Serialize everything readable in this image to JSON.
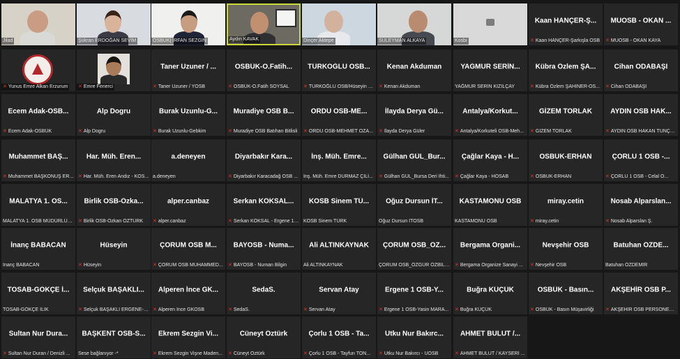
{
  "colors": {
    "background": "#171717",
    "tile": "#262626",
    "active_border": "#c9d836",
    "mic_muted": "#e0362c"
  },
  "icons": {
    "mic_muted": "muted-mic-icon",
    "no_camera": "camera-off-icon"
  },
  "rows": [
    [
      {
        "caption": "Jilad",
        "video": true,
        "mic": false
      },
      {
        "caption": "Şükran ERDOĞAN SEVİM",
        "video": true,
        "mic": false
      },
      {
        "caption": "OSBÜK| İRFAN SEZGİN",
        "video": true,
        "mic": false
      },
      {
        "caption": "Aydın KAVAK",
        "video": true,
        "mic": false,
        "active": true
      },
      {
        "caption": "Dinçer Aktepe",
        "video": true,
        "mic": false
      },
      {
        "caption": "SÜLEYMAN ALKAYA",
        "video": true,
        "mic": false
      },
      {
        "caption": "Kosbi",
        "video": true,
        "mic": false,
        "placeholder": true
      },
      {
        "name": "Kaan HANÇER-Ş...",
        "caption": "Kaan HANÇER-Şarkışla OSB",
        "mic": true
      },
      {
        "name": "MUOSB - OKAN ...",
        "caption": "MUOSB - OKAN KAYA",
        "mic": true
      }
    ],
    [
      {
        "caption": "Yunus Emre Alkan Erzurum",
        "video": true,
        "mic": true,
        "logo": true
      },
      {
        "caption": "Emre Fenerci",
        "video": true,
        "mic": true,
        "portrait": true
      },
      {
        "name": "Taner Uzuner / ...",
        "caption": "Taner Uzuner / YOSB",
        "mic": true
      },
      {
        "name": "OSBÜK-O.Fatih...",
        "caption": "OSBÜK-O.Fatih SOYSAL",
        "mic": true
      },
      {
        "name": "TÜRKOĞLU OSB...",
        "caption": "TÜRKOĞLU OSB/Hüseyin Ş...",
        "mic": true
      },
      {
        "name": "Kenan Akduman",
        "caption": "Kenan Akduman",
        "mic": true
      },
      {
        "name": "YAĞMUR SERİN...",
        "caption": "YAĞMUR SERİN KIZILÇAY",
        "mic": false
      },
      {
        "name": "Kübra Özlem ŞA...",
        "caption": "Kübra Özlem ŞAHİNER-OS...",
        "mic": true
      },
      {
        "name": "Cihan ODABAŞI",
        "caption": "Cihan ODABAŞI",
        "mic": true
      }
    ],
    [
      {
        "name": "Ecem Adak-OSB...",
        "caption": "Ecem Adak-OSBÜK",
        "mic": true
      },
      {
        "name": "Alp Dogru",
        "caption": "Alp Dogru",
        "mic": true
      },
      {
        "name": "Burak Uzunlu-G...",
        "caption": "Burak Uzunlu-Gebkim",
        "mic": true
      },
      {
        "name": "Muradiye OSB B...",
        "caption": "Muradiye OSB Batıhan Bitlisli",
        "mic": true
      },
      {
        "name": "ORDU OSB-ME...",
        "caption": "ORDU OSB-MEHMET OZA...",
        "mic": true
      },
      {
        "name": "İlayda Derya Gü...",
        "caption": "İlayda Derya Güler",
        "mic": true
      },
      {
        "name": "Antalya/Korkut...",
        "caption": "Antalya/Korkuteli OSB-Meh...",
        "mic": true
      },
      {
        "name": "GİZEM TORLAK",
        "caption": "GİZEM TORLAK",
        "mic": true
      },
      {
        "name": "AYDIN OSB HAK...",
        "caption": "AYDIN OSB HAKAN TUNÇK...",
        "mic": true
      }
    ],
    [
      {
        "name": "Muhammet BAŞ...",
        "caption": "Muhammet BAŞKONUŞ ER...",
        "mic": true
      },
      {
        "name": "Har. Müh. Eren...",
        "caption": "Har. Müh. Eren Andız - KOS...",
        "mic": true
      },
      {
        "name": "a.deneyen",
        "caption": "a.deneyen",
        "mic": false
      },
      {
        "name": "Diyarbakır Kara...",
        "caption": "Diyarbakır Karacadağ OSB ...",
        "mic": true
      },
      {
        "name": "İnş. Müh. Emre...",
        "caption": "İnş. Müh. Emre DURMAZ ÇİLİ...",
        "mic": false
      },
      {
        "name": "Gülhan GÜL_Bur...",
        "caption": "Gülhan GÜL_Bursa Deri İhti...",
        "mic": true
      },
      {
        "name": "Çağlar Kaya - H...",
        "caption": "Çağlar Kaya - HOSAB",
        "mic": true
      },
      {
        "name": "OSBUK-ERHAN",
        "caption": "OSBUK-ERHAN",
        "mic": true
      },
      {
        "name": "ÇORLU 1 OSB -...",
        "caption": "ÇORLU 1 OSB - Celal Ö...",
        "mic": true
      }
    ],
    [
      {
        "name": "MALATYA 1. OS...",
        "caption": "MALATYA 1. OSB MÜDÜRLÜĞÜ",
        "mic": false
      },
      {
        "name": "Birlik OSB-Özka...",
        "caption": "Birlik OSB-Özkan ÖZTÜRK",
        "mic": true
      },
      {
        "name": "alper.canbaz",
        "caption": "alper.canbaz",
        "mic": true
      },
      {
        "name": "Serkan KÖKSAL...",
        "caption": "Serkan KÖKSAL - Ergene 1 ...",
        "mic": true
      },
      {
        "name": "KOSB Sinem TÜ...",
        "caption": "KOSB Sinem TÜRK",
        "mic": false
      },
      {
        "name": "Oğuz Dursun İT...",
        "caption": "Oğuz Dursun İTOSB",
        "mic": false
      },
      {
        "name": "KASTAMONU OSB",
        "caption": "KASTAMONU OSB",
        "mic": false
      },
      {
        "name": "miray.cetin",
        "caption": "miray.cetin",
        "mic": true
      },
      {
        "name": "Nosab Alparslan...",
        "caption": "Nosab Alparslan Ş.",
        "mic": true
      }
    ],
    [
      {
        "name": "İnanç BABACAN",
        "caption": "İnanç BABACAN",
        "mic": false
      },
      {
        "name": "Hüseyin",
        "caption": "Hüseyin",
        "mic": true
      },
      {
        "name": "ÇORUM OSB M...",
        "caption": "ÇORUM OSB MUHAMMED...",
        "mic": true
      },
      {
        "name": "BAYOSB - Numa...",
        "caption": "BAYOSB - Numan Bilgin",
        "mic": true
      },
      {
        "name": "Ali ALTINKAYNAK",
        "caption": "Ali ALTINKAYNAK",
        "mic": false
      },
      {
        "name": "ÇORUM OSB_ÖZ...",
        "caption": "ÇORUM OSB_ÖZGÜR ÖZBİLEN",
        "mic": false
      },
      {
        "name": "Bergama Organi...",
        "caption": "Bergama Organize Sanayi ...",
        "mic": true
      },
      {
        "name": "Nevşehir OSB",
        "caption": "Nevşehir OSB",
        "mic": true
      },
      {
        "name": "Batuhan ÖZDE...",
        "caption": "Batuhan ÖZDEMİR",
        "mic": false
      }
    ],
    [
      {
        "name": "TOSAB-GÖKÇE İ...",
        "caption": "TOSAB-GÖKÇE İLİK",
        "mic": false
      },
      {
        "name": "Selçuk BAŞAKLI...",
        "caption": "Selçuk BAŞAKLI ERGENE-2 ...",
        "mic": true
      },
      {
        "name": "Alperen İnce GK...",
        "caption": "Alperen İnce GKOSB",
        "mic": true
      },
      {
        "name": "SedaS.",
        "caption": "SedaS.",
        "mic": true
      },
      {
        "name": "Servan Atay",
        "caption": "Servan Atay",
        "mic": true
      },
      {
        "name": "Ergene 1 OSB-Y...",
        "caption": "Ergene 1 OSB-Yasin MARA...",
        "mic": true
      },
      {
        "name": "Buğra KÜÇÜK",
        "caption": "Buğra KÜÇÜK",
        "mic": true
      },
      {
        "name": "OSBÜK - Basın...",
        "caption": "OSBÜK - Basın Müşavirliği",
        "mic": true
      },
      {
        "name": "AKŞEHİR OSB P...",
        "caption": "AKŞEHİR OSB PERSONELİ ...",
        "mic": true
      }
    ],
    [
      {
        "name": "Sultan Nur Dura...",
        "caption": "Sultan Nur Duran / Denizli ...",
        "mic": true
      },
      {
        "name": "BAŞKENT OSB-S...",
        "caption": "Sese bağlanıyor -*",
        "mic": false
      },
      {
        "name": "Ekrem Sezgin Vi...",
        "caption": "Ekrem Sezgin Vişne Maden...",
        "mic": true
      },
      {
        "name": "Cüneyt Öztürk",
        "caption": "Cüneyt Öztürk",
        "mic": true
      },
      {
        "name": "Çorlu 1 OSB - Ta...",
        "caption": "Çorlu 1 OSB - Tayfun TON...",
        "mic": true
      },
      {
        "name": "Utku Nur Bakırc...",
        "caption": "Utku Nur Bakırcı - UOSB",
        "mic": true
      },
      {
        "name": "AHMET BULUT /...",
        "caption": "AHMET BULUT / KAYSERİ ...",
        "mic": true
      }
    ]
  ]
}
